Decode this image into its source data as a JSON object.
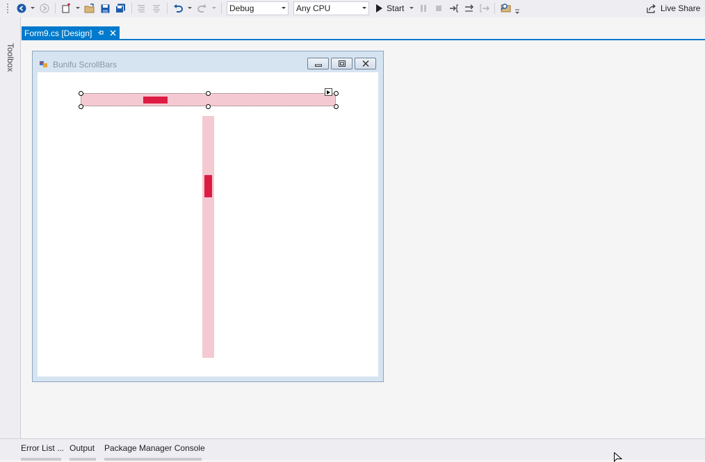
{
  "toolbar": {
    "config_value": "Debug",
    "platform_value": "Any CPU",
    "start_label": "Start",
    "live_share_label": "Live Share"
  },
  "sidebar": {
    "toolbox_label": "Toolbox"
  },
  "document_tab": {
    "title": "Form9.cs [Design]"
  },
  "form": {
    "title": "Bunifu ScrollBars",
    "hscroll_value_fraction": 0.27,
    "vscroll_value_fraction": 0.27,
    "track_color": "#f5c9d1",
    "thumb_color": "#dc1c43"
  },
  "bottom_tabs": [
    {
      "label": "Error List ..."
    },
    {
      "label": "Output"
    },
    {
      "label": "Package Manager Console"
    }
  ],
  "colors": {
    "accent": "#007acc",
    "toolbar_bg": "#eeeef2",
    "surface_bg": "#f5f5f5"
  }
}
